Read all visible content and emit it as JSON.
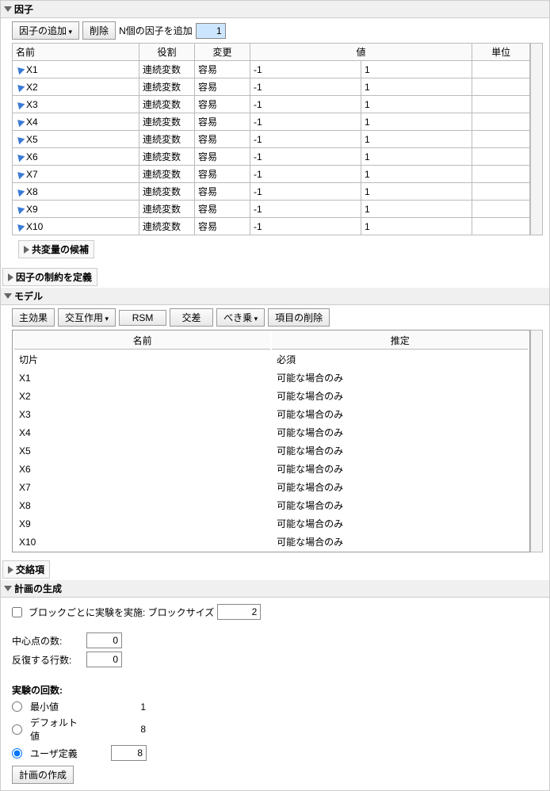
{
  "factors": {
    "title": "因子",
    "toolbar": {
      "add": "因子の追加",
      "delete": "削除",
      "addN_label": "N個の因子を追加",
      "addN_value": "1"
    },
    "headers": {
      "name": "名前",
      "role": "役割",
      "change": "変更",
      "values": "値",
      "unit": "単位"
    },
    "roleVal": "連続変数",
    "changeVal": "容易",
    "rows": [
      {
        "name": "X1",
        "v1": "-1",
        "v2": "1"
      },
      {
        "name": "X2",
        "v1": "-1",
        "v2": "1"
      },
      {
        "name": "X3",
        "v1": "-1",
        "v2": "1"
      },
      {
        "name": "X4",
        "v1": "-1",
        "v2": "1"
      },
      {
        "name": "X5",
        "v1": "-1",
        "v2": "1"
      },
      {
        "name": "X6",
        "v1": "-1",
        "v2": "1"
      },
      {
        "name": "X7",
        "v1": "-1",
        "v2": "1"
      },
      {
        "name": "X8",
        "v1": "-1",
        "v2": "1"
      },
      {
        "name": "X9",
        "v1": "-1",
        "v2": "1"
      },
      {
        "name": "X10",
        "v1": "-1",
        "v2": "1"
      }
    ]
  },
  "covariate": {
    "title": "共変量の候補"
  },
  "constraints": {
    "title": "因子の制約を定義"
  },
  "model": {
    "title": "モデル",
    "toolbar": {
      "main": "主効果",
      "inter": "交互作用",
      "rsm": "RSM",
      "cross": "交差",
      "power": "べき乗",
      "remove": "項目の削除"
    },
    "headers": {
      "name": "名前",
      "estimate": "推定"
    },
    "interceptName": "切片",
    "interceptEst": "必須",
    "estVal": "可能な場合のみ",
    "rows": [
      "X1",
      "X2",
      "X3",
      "X4",
      "X5",
      "X6",
      "X7",
      "X8",
      "X9",
      "X10"
    ]
  },
  "alias": {
    "title": "交絡項"
  },
  "design": {
    "title": "計画の生成",
    "block_label": "ブロックごとに実験を実施: ブロックサイズ",
    "block_value": "2",
    "center_label": "中心点の数:",
    "center_value": "0",
    "repeat_label": "反復する行数:",
    "repeat_value": "0",
    "runs_label": "実験の回数:",
    "opt_min": "最小値",
    "opt_min_val": "1",
    "opt_def": "デフォルト値",
    "opt_def_val": "8",
    "opt_user": "ユーザ定義",
    "opt_user_val": "8",
    "make": "計画の作成"
  }
}
